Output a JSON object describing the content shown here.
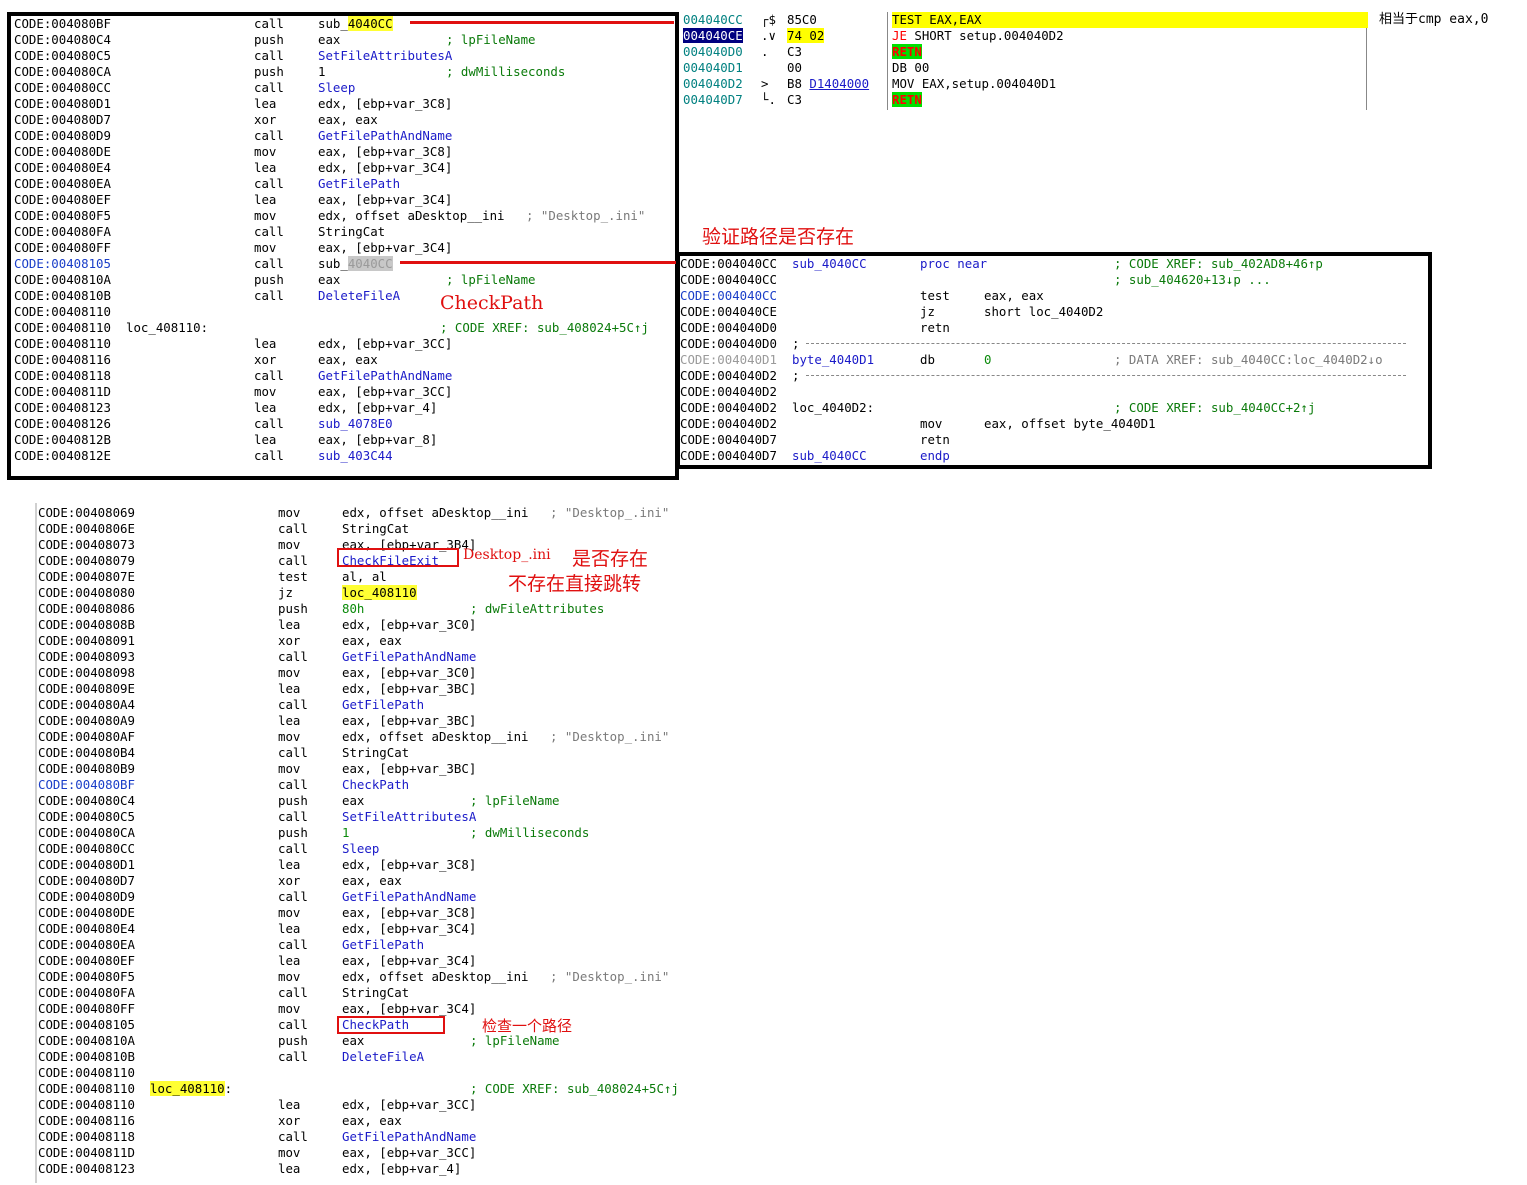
{
  "top_left_panel": {
    "rows": [
      {
        "addr": "CODE:004080BF",
        "mn": "call",
        "op": "sub_",
        "op_hl": "4040CC",
        "cmt": ""
      },
      {
        "addr": "CODE:004080C4",
        "mn": "push",
        "op": "eax",
        "cmt": "; lpFileName"
      },
      {
        "addr": "CODE:004080C5",
        "mn": "call",
        "op": "SetFileAttributesA",
        "cmt": ""
      },
      {
        "addr": "CODE:004080CA",
        "mn": "push",
        "op": "1",
        "cmt": "; dwMilliseconds"
      },
      {
        "addr": "CODE:004080CC",
        "mn": "call",
        "op": "Sleep",
        "cmt": ""
      },
      {
        "addr": "CODE:004080D1",
        "mn": "lea",
        "op": "edx, [ebp+var_3C8]",
        "cmt": ""
      },
      {
        "addr": "CODE:004080D7",
        "mn": "xor",
        "op": "eax, eax",
        "cmt": ""
      },
      {
        "addr": "CODE:004080D9",
        "mn": "call",
        "op": "GetFilePathAndName",
        "cmt": ""
      },
      {
        "addr": "CODE:004080DE",
        "mn": "mov",
        "op": "eax, [ebp+var_3C8]",
        "cmt": ""
      },
      {
        "addr": "CODE:004080E4",
        "mn": "lea",
        "op": "edx, [ebp+var_3C4]",
        "cmt": ""
      },
      {
        "addr": "CODE:004080EA",
        "mn": "call",
        "op": "GetFilePath",
        "cmt": ""
      },
      {
        "addr": "CODE:004080EF",
        "mn": "lea",
        "op": "eax, [ebp+var_3C4]",
        "cmt": ""
      },
      {
        "addr": "CODE:004080F5",
        "mn": "mov",
        "op": "edx, offset aDesktop__ini",
        "cmt": "; \"Desktop_.ini\""
      },
      {
        "addr": "CODE:004080FA",
        "mn": "call",
        "op": "StringCat",
        "cmt": ""
      },
      {
        "addr": "CODE:004080FF",
        "mn": "mov",
        "op": "eax, [ebp+var_3C4]",
        "cmt": ""
      },
      {
        "addr": "CODE:00408105",
        "mn": "call",
        "op": "sub_",
        "op_sel": "4040CC",
        "cmt": ""
      },
      {
        "addr": "CODE:0040810A",
        "mn": "push",
        "op": "eax",
        "cmt": "; lpFileName"
      },
      {
        "addr": "CODE:0040810B",
        "mn": "call",
        "op": "DeleteFileA",
        "cmt": ""
      },
      {
        "addr": "CODE:00408110",
        "mn": "",
        "op": "",
        "cmt": ""
      },
      {
        "addr": "CODE:00408110",
        "label": "loc_408110:",
        "mn": "",
        "op": "",
        "cmt": "; CODE XREF: sub_408024+5C↑j"
      },
      {
        "addr": "CODE:00408110",
        "mn": "lea",
        "op": "edx, [ebp+var_3CC]",
        "cmt": ""
      },
      {
        "addr": "CODE:00408116",
        "mn": "xor",
        "op": "eax, eax",
        "cmt": ""
      },
      {
        "addr": "CODE:00408118",
        "mn": "call",
        "op": "GetFilePathAndName",
        "cmt": ""
      },
      {
        "addr": "CODE:0040811D",
        "mn": "mov",
        "op": "eax, [ebp+var_3CC]",
        "cmt": ""
      },
      {
        "addr": "CODE:00408123",
        "mn": "lea",
        "op": "edx, [ebp+var_4]",
        "cmt": ""
      },
      {
        "addr": "CODE:00408126",
        "mn": "call",
        "op": "sub_4078E0",
        "cmt": ""
      },
      {
        "addr": "CODE:0040812B",
        "mn": "lea",
        "op": "eax, [ebp+var_8]",
        "cmt": ""
      },
      {
        "addr": "CODE:0040812E",
        "mn": "call",
        "op": "sub_403C44",
        "cmt": ""
      }
    ],
    "annotation": "CheckPath"
  },
  "debugger_panel": {
    "rows": [
      {
        "addr": "004040CC",
        "marker": "┌$",
        "bytes": "85C0",
        "asm": "TEST EAX,EAX"
      },
      {
        "addr": "004040CE",
        "marker": ".∨",
        "bytes": "74 02",
        "asm_kw": "JE",
        "asm": " SHORT setup.004040D2"
      },
      {
        "addr": "004040D0",
        "marker": ".",
        "bytes": "C3",
        "asm_retn": "RETN"
      },
      {
        "addr": "004040D1",
        "marker": "",
        "bytes": "00",
        "asm": "DB 00"
      },
      {
        "addr": "004040D2",
        "marker": ">",
        "bytes": "B8",
        "bytes_ul": "D1404000",
        "asm": "MOV EAX,setup.004040D1"
      },
      {
        "addr": "004040D7",
        "marker": "└.",
        "bytes": "C3",
        "asm_retn": "RETN"
      }
    ],
    "comment": "相当于cmp eax,0"
  },
  "verify_note": "验证路径是否存在",
  "proc_panel": {
    "rows": [
      {
        "addr": "CODE:004040CC",
        "label": "sub_4040CC",
        "mn": "proc near",
        "op": "",
        "cmt": "; CODE XREF: sub_402AD8+46↑p"
      },
      {
        "addr": "CODE:004040CC",
        "label": "",
        "mn": "",
        "op": "",
        "cmt": "; sub_404620+13↓p ..."
      },
      {
        "addr": "CODE:004040CC",
        "label": "",
        "mn": "test",
        "op": "eax, eax",
        "cmt": ""
      },
      {
        "addr": "CODE:004040CE",
        "label": "",
        "mn": "jz",
        "op": "short loc_4040D2",
        "cmt": ""
      },
      {
        "addr": "CODE:004040D0",
        "label": "",
        "mn": "retn",
        "op": "",
        "cmt": ""
      },
      {
        "addr": "CODE:004040D0",
        "label": ";",
        "mn": "",
        "op": "",
        "cmt": "",
        "sep": true
      },
      {
        "addr": "CODE:004040D1",
        "label": "byte_4040D1",
        "mn": "db",
        "op": "0",
        "cmt": "; DATA XREF: sub_4040CC:loc_4040D2↓o"
      },
      {
        "addr": "CODE:004040D2",
        "label": ";",
        "mn": "",
        "op": "",
        "cmt": "",
        "sep": true
      },
      {
        "addr": "CODE:004040D2",
        "label": "",
        "mn": "",
        "op": "",
        "cmt": ""
      },
      {
        "addr": "CODE:004040D2",
        "label": "loc_4040D2:",
        "mn": "",
        "op": "",
        "cmt": "; CODE XREF: sub_4040CC+2↑j"
      },
      {
        "addr": "CODE:004040D2",
        "label": "",
        "mn": "mov",
        "op": "eax, offset byte_4040D1",
        "cmt": ""
      },
      {
        "addr": "CODE:004040D7",
        "label": "",
        "mn": "retn",
        "op": "",
        "cmt": ""
      },
      {
        "addr": "CODE:004040D7",
        "label": "sub_4040CC",
        "mn": "endp",
        "op": "",
        "cmt": ""
      }
    ]
  },
  "bottom_panel": {
    "rows": [
      {
        "addr": "CODE:00408069",
        "mn": "mov",
        "op": "edx, offset aDesktop__ini",
        "cmt": "; \"Desktop_.ini\""
      },
      {
        "addr": "CODE:0040806E",
        "mn": "call",
        "op": "StringCat",
        "cmt": ""
      },
      {
        "addr": "CODE:00408073",
        "mn": "mov",
        "op": "eax, [ebp+var_3B4]",
        "cmt": ""
      },
      {
        "addr": "CODE:00408079",
        "mn": "call",
        "op": "CheckFileExit",
        "cmt": ""
      },
      {
        "addr": "CODE:0040807E",
        "mn": "test",
        "op": "al, al",
        "cmt": ""
      },
      {
        "addr": "CODE:00408080",
        "mn": "jz",
        "op": "loc_408110",
        "cmt": ""
      },
      {
        "addr": "CODE:00408086",
        "mn": "push",
        "op": "80h",
        "cmt": "; dwFileAttributes"
      },
      {
        "addr": "CODE:0040808B",
        "mn": "lea",
        "op": "edx, [ebp+var_3C0]",
        "cmt": ""
      },
      {
        "addr": "CODE:00408091",
        "mn": "xor",
        "op": "eax, eax",
        "cmt": ""
      },
      {
        "addr": "CODE:00408093",
        "mn": "call",
        "op": "GetFilePathAndName",
        "cmt": ""
      },
      {
        "addr": "CODE:00408098",
        "mn": "mov",
        "op": "eax, [ebp+var_3C0]",
        "cmt": ""
      },
      {
        "addr": "CODE:0040809E",
        "mn": "lea",
        "op": "edx, [ebp+var_3BC]",
        "cmt": ""
      },
      {
        "addr": "CODE:004080A4",
        "mn": "call",
        "op": "GetFilePath",
        "cmt": ""
      },
      {
        "addr": "CODE:004080A9",
        "mn": "lea",
        "op": "eax, [ebp+var_3BC]",
        "cmt": ""
      },
      {
        "addr": "CODE:004080AF",
        "mn": "mov",
        "op": "edx, offset aDesktop__ini",
        "cmt": "; \"Desktop_.ini\""
      },
      {
        "addr": "CODE:004080B4",
        "mn": "call",
        "op": "StringCat",
        "cmt": ""
      },
      {
        "addr": "CODE:004080B9",
        "mn": "mov",
        "op": "eax, [ebp+var_3BC]",
        "cmt": ""
      },
      {
        "addr": "CODE:004080BF",
        "mn": "call",
        "op": "CheckPath",
        "cmt": "",
        "cur": true
      },
      {
        "addr": "CODE:004080C4",
        "mn": "push",
        "op": "eax",
        "cmt": "; lpFileName"
      },
      {
        "addr": "CODE:004080C5",
        "mn": "call",
        "op": "SetFileAttributesA",
        "cmt": ""
      },
      {
        "addr": "CODE:004080CA",
        "mn": "push",
        "op": "1",
        "cmt": "; dwMilliseconds"
      },
      {
        "addr": "CODE:004080CC",
        "mn": "call",
        "op": "Sleep",
        "cmt": ""
      },
      {
        "addr": "CODE:004080D1",
        "mn": "lea",
        "op": "edx, [ebp+var_3C8]",
        "cmt": ""
      },
      {
        "addr": "CODE:004080D7",
        "mn": "xor",
        "op": "eax, eax",
        "cmt": ""
      },
      {
        "addr": "CODE:004080D9",
        "mn": "call",
        "op": "GetFilePathAndName",
        "cmt": ""
      },
      {
        "addr": "CODE:004080DE",
        "mn": "mov",
        "op": "eax, [ebp+var_3C8]",
        "cmt": ""
      },
      {
        "addr": "CODE:004080E4",
        "mn": "lea",
        "op": "edx, [ebp+var_3C4]",
        "cmt": ""
      },
      {
        "addr": "CODE:004080EA",
        "mn": "call",
        "op": "GetFilePath",
        "cmt": ""
      },
      {
        "addr": "CODE:004080EF",
        "mn": "lea",
        "op": "eax, [ebp+var_3C4]",
        "cmt": ""
      },
      {
        "addr": "CODE:004080F5",
        "mn": "mov",
        "op": "edx, offset aDesktop__ini",
        "cmt": "; \"Desktop_.ini\""
      },
      {
        "addr": "CODE:004080FA",
        "mn": "call",
        "op": "StringCat",
        "cmt": ""
      },
      {
        "addr": "CODE:004080FF",
        "mn": "mov",
        "op": "eax, [ebp+var_3C4]",
        "cmt": ""
      },
      {
        "addr": "CODE:00408105",
        "mn": "call",
        "op": "CheckPath",
        "cmt": ""
      },
      {
        "addr": "CODE:0040810A",
        "mn": "push",
        "op": "eax",
        "cmt": "; lpFileName"
      },
      {
        "addr": "CODE:0040810B",
        "mn": "call",
        "op": "DeleteFileA",
        "cmt": ""
      },
      {
        "addr": "CODE:00408110",
        "mn": "",
        "op": "",
        "cmt": ""
      },
      {
        "addr": "CODE:00408110",
        "label": "loc_408110",
        "mn": "",
        "op": "",
        "cmt": "; CODE XREF: sub_408024+5C↑j"
      },
      {
        "addr": "CODE:00408110",
        "mn": "lea",
        "op": "edx, [ebp+var_3CC]",
        "cmt": ""
      },
      {
        "addr": "CODE:00408116",
        "mn": "xor",
        "op": "eax, eax",
        "cmt": ""
      },
      {
        "addr": "CODE:00408118",
        "mn": "call",
        "op": "GetFilePathAndName",
        "cmt": ""
      },
      {
        "addr": "CODE:0040811D",
        "mn": "mov",
        "op": "eax, [ebp+var_3CC]",
        "cmt": ""
      },
      {
        "addr": "CODE:00408123",
        "mn": "lea",
        "op": "edx, [ebp+var_4]",
        "cmt": ""
      }
    ],
    "note_desktop": "Desktop_.ini",
    "note_exist": "是否存在",
    "note_jump": "不存在直接跳转",
    "note_check": "检查一个路径"
  },
  "colors": {
    "annotation_red": "#e01010",
    "highlight_yellow": "#ffff33",
    "function_blue": "#1a1ac8",
    "comment_green": "#0a7a0a"
  }
}
